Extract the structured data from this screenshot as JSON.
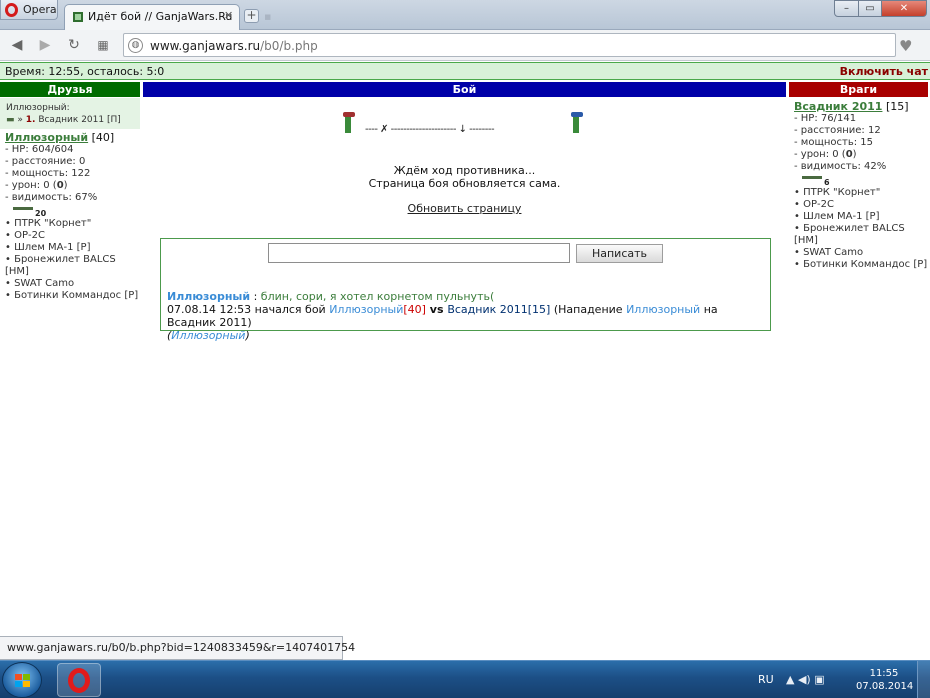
{
  "browser": {
    "menu_label": "Opera",
    "tab_title": "Идёт бой // GanjaWars.Ru",
    "address_host": "www.ganjawars.ru",
    "address_path": "/b0/b.php",
    "status_url": "www.ganjawars.ru/b0/b.php?bid=1240833459&r=1407401754"
  },
  "topbar": {
    "time_text": "Время: 12:55, осталось:  5:0",
    "chat_link": "Включить чат"
  },
  "headers": {
    "friends": "Друзья",
    "battle": "Бой",
    "enemies": "Враги"
  },
  "friend": {
    "target_caption": "Иллюзорный:",
    "target_num": "1.",
    "target_text": "Всадник 2011 [П]",
    "name": "Иллюзорный",
    "level": "[40]",
    "stats": [
      "- HP: 604/604",
      "- расстояние: 0",
      "- мощность: 122"
    ],
    "damage_prefix": "- урон: 0 (",
    "damage_bold": "0",
    "damage_suffix": ")",
    "visibility": "- видимость: 67%",
    "gun_badge": "20",
    "items": [
      "• ПТРК \"Корнет\"",
      "• ОР-2С",
      "• Шлем МА-1 [Р]",
      "• Бронежилет BALCS [НМ]",
      "• SWAT Camo",
      "• Ботинки Коммандос [Р]"
    ]
  },
  "battle": {
    "field_line": "----  ✗  ---------------------  ↓  --------",
    "waiting_line1": "Ждём ход противника...",
    "waiting_line2": "Страница боя обновляется сама.",
    "refresh_link": "Обновить страницу",
    "send_button": "Написать",
    "input_value": ""
  },
  "chat": {
    "msg_author": "Иллюзорный",
    "msg_sep": " : ",
    "msg_text": "блин, сори, я хотел корнетом пульнуть(",
    "log_prefix": "07.08.14 12:53 начался бой ",
    "log_p1": "Иллюзорный",
    "log_p1_level": "[40]",
    "log_vs": " vs ",
    "log_p2": "Всадник 2011",
    "log_p2_level": "[15]",
    "log_attack_prefix": " (Нападение ",
    "log_attack_p1": "Иллюзорный",
    "log_attack_suffix": " на Всадник 2011)",
    "log_last_open": "(",
    "log_last": "Иллюзорный",
    "log_last_close": ")"
  },
  "enemy": {
    "name": "Всадник 2011",
    "level": "[15]",
    "stats": [
      "- HP: 76/141",
      "- расстояние: 12",
      "- мощность: 15"
    ],
    "damage_prefix": "- урон: 0 (",
    "damage_bold": "0",
    "damage_suffix": ")",
    "visibility": "- видимость: 42%",
    "gun_badge": "6",
    "items": [
      "• ПТРК \"Корнет\"",
      "• ОР-2С",
      "• Шлем МА-1 [Р]",
      "• Бронежилет BALCS [НМ]",
      "• SWAT Camo",
      "• Ботинки Коммандос [Р]"
    ]
  },
  "taskbar": {
    "lang": "RU",
    "time": "11:55",
    "date": "07.08.2014"
  },
  "colors": {
    "friends": "#006b00",
    "battle": "#0000a8",
    "enemies": "#a80000",
    "topbar": "#d8f1d8",
    "link_blue": "#3a8cd6"
  }
}
